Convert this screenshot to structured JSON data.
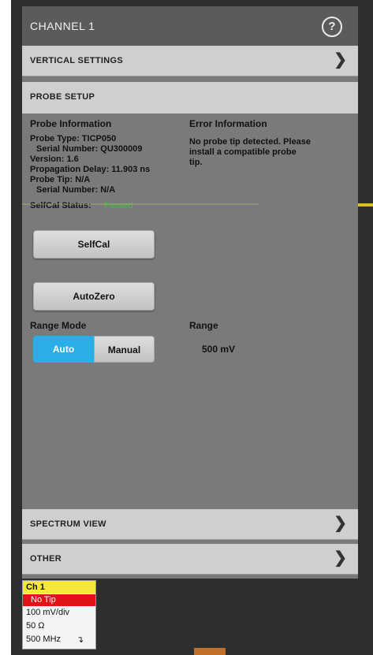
{
  "header": {
    "title": "CHANNEL 1"
  },
  "sections": {
    "vertical": "VERTICAL SETTINGS",
    "probe": "PROBE SETUP",
    "spectrum": "SPECTRUM VIEW",
    "other": "OTHER"
  },
  "probe_info": {
    "heading": "Probe Information",
    "type": "Probe Type: TICP050",
    "serial": "Serial Number: QU300009",
    "version": "Version: 1.6",
    "delay": "Propagation Delay: 11.903 ns",
    "tip": "Probe Tip: N/A",
    "tip_serial": "Serial Number: N/A"
  },
  "error_info": {
    "heading": "Error Information",
    "message_line1": "No probe tip detected. Please",
    "message_line2": "install a compatible probe",
    "message_line3": "tip."
  },
  "selfcal": {
    "status_label": "SelfCal Status:",
    "status_value": "Passed",
    "status_color": "#3fbf3f",
    "button": "SelfCal"
  },
  "autozero": {
    "button": "AutoZero"
  },
  "range_mode": {
    "label": "Range Mode",
    "options": [
      "Auto",
      "Manual"
    ],
    "selected": "Auto"
  },
  "range": {
    "label": "Range",
    "value": "500 mV"
  },
  "channel_badge": {
    "name": "Ch 1",
    "tip_status": "No Tip",
    "scale": "100 mV/div",
    "impedance": "50 Ω",
    "bandwidth": "500 MHz"
  },
  "icons": {
    "help": "help-icon",
    "chevron": "chevron-right-icon"
  }
}
